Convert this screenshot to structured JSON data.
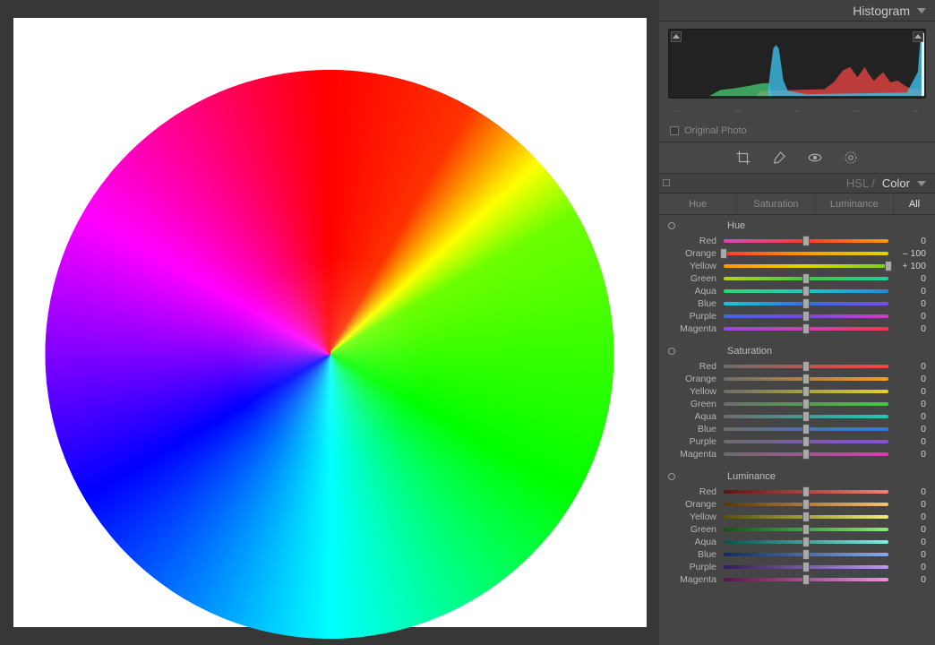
{
  "header": {
    "title": "Histogram"
  },
  "hist_ticks": [
    "–",
    "–",
    "–",
    "–",
    "–"
  ],
  "original_photo_label": "Original Photo",
  "hsl_header": {
    "inactive": "HSL /",
    "active": "Color"
  },
  "tabs": [
    {
      "label": "Hue",
      "active": false
    },
    {
      "label": "Saturation",
      "active": false
    },
    {
      "label": "Luminance",
      "active": false
    },
    {
      "label": "All",
      "active": true
    }
  ],
  "sections": [
    {
      "title": "Hue",
      "gprefix": "g",
      "sliders": [
        {
          "color": "Red",
          "value": "0",
          "pct": 50,
          "cls": "red"
        },
        {
          "color": "Orange",
          "value": "– 100",
          "pct": 0,
          "cls": "orange"
        },
        {
          "color": "Yellow",
          "value": "+ 100",
          "pct": 100,
          "cls": "yellow"
        },
        {
          "color": "Green",
          "value": "0",
          "pct": 50,
          "cls": "green"
        },
        {
          "color": "Aqua",
          "value": "0",
          "pct": 50,
          "cls": "aqua"
        },
        {
          "color": "Blue",
          "value": "0",
          "pct": 50,
          "cls": "blue"
        },
        {
          "color": "Purple",
          "value": "0",
          "pct": 50,
          "cls": "purple"
        },
        {
          "color": "Magenta",
          "value": "0",
          "pct": 50,
          "cls": "magenta"
        }
      ]
    },
    {
      "title": "Saturation",
      "gprefix": "s",
      "sliders": [
        {
          "color": "Red",
          "value": "0",
          "pct": 50,
          "cls": "red"
        },
        {
          "color": "Orange",
          "value": "0",
          "pct": 50,
          "cls": "orange"
        },
        {
          "color": "Yellow",
          "value": "0",
          "pct": 50,
          "cls": "yellow"
        },
        {
          "color": "Green",
          "value": "0",
          "pct": 50,
          "cls": "green"
        },
        {
          "color": "Aqua",
          "value": "0",
          "pct": 50,
          "cls": "aqua"
        },
        {
          "color": "Blue",
          "value": "0",
          "pct": 50,
          "cls": "blue"
        },
        {
          "color": "Purple",
          "value": "0",
          "pct": 50,
          "cls": "purple"
        },
        {
          "color": "Magenta",
          "value": "0",
          "pct": 50,
          "cls": "magenta"
        }
      ]
    },
    {
      "title": "Luminance",
      "gprefix": "l",
      "sliders": [
        {
          "color": "Red",
          "value": "0",
          "pct": 50,
          "cls": "red"
        },
        {
          "color": "Orange",
          "value": "0",
          "pct": 50,
          "cls": "orange"
        },
        {
          "color": "Yellow",
          "value": "0",
          "pct": 50,
          "cls": "yellow"
        },
        {
          "color": "Green",
          "value": "0",
          "pct": 50,
          "cls": "green"
        },
        {
          "color": "Aqua",
          "value": "0",
          "pct": 50,
          "cls": "aqua"
        },
        {
          "color": "Blue",
          "value": "0",
          "pct": 50,
          "cls": "blue"
        },
        {
          "color": "Purple",
          "value": "0",
          "pct": 50,
          "cls": "purple"
        },
        {
          "color": "Magenta",
          "value": "0",
          "pct": 50,
          "cls": "magenta"
        }
      ]
    }
  ]
}
